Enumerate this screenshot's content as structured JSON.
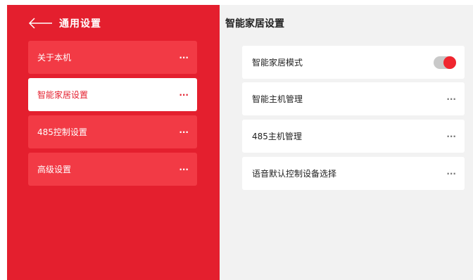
{
  "sidebar": {
    "title": "通用设置",
    "items": [
      {
        "label": "关于本机",
        "more": "···"
      },
      {
        "label": "智能家居设置",
        "more": "···"
      },
      {
        "label": "485控制设置",
        "more": "···"
      },
      {
        "label": "高级设置",
        "more": "···"
      }
    ]
  },
  "main": {
    "title": "智能家居设置",
    "rows": [
      {
        "label": "智能家居模式",
        "toggle_on": true
      },
      {
        "label": "智能主机管理",
        "more": "···"
      },
      {
        "label": "485主机管理",
        "more": "···"
      },
      {
        "label": "语音默认控制设备选择",
        "more": "···"
      }
    ]
  },
  "colors": {
    "sidebar_bg": "#e41f2e",
    "item_bg": "#f23a45",
    "active_item_bg": "#ffffff",
    "main_bg": "#f2f2f2",
    "toggle_accent": "#f0262f"
  },
  "icons": {
    "back": "arrow-left-icon",
    "more": "more-dots-icon"
  }
}
